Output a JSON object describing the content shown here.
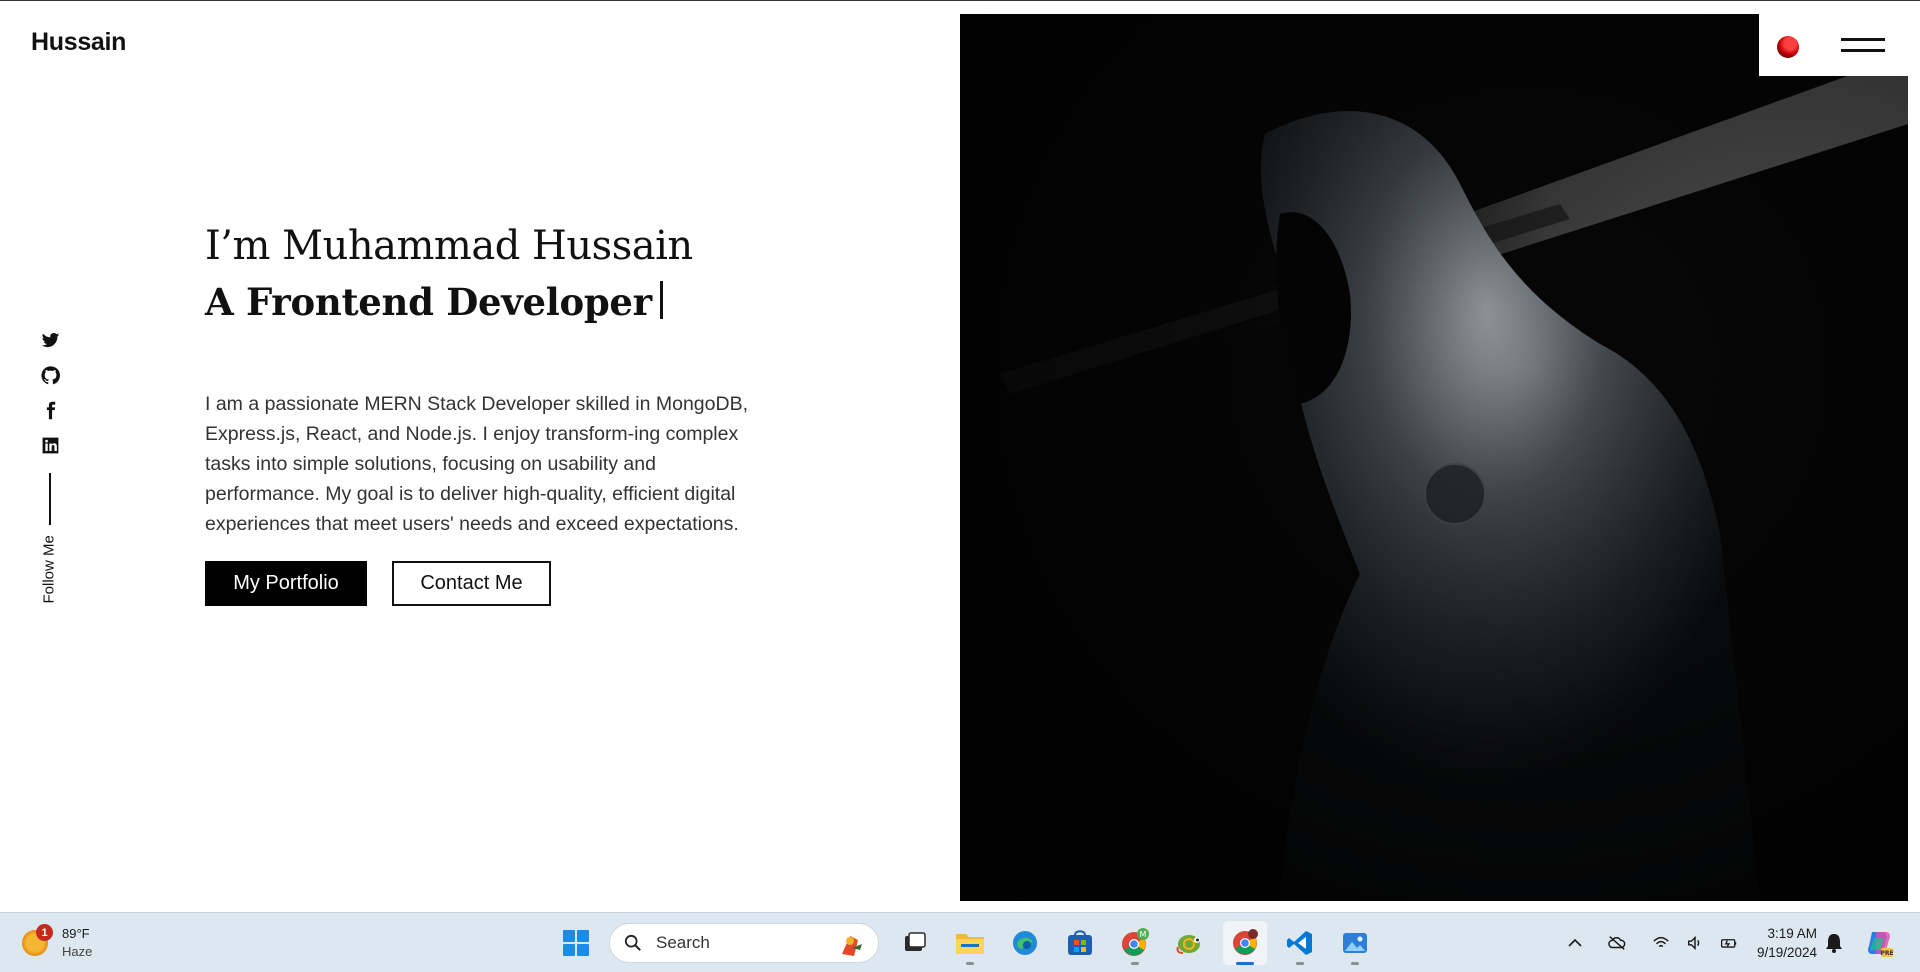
{
  "header": {
    "brand": "Hussain"
  },
  "social": {
    "items": [
      {
        "icon": "twitter-icon"
      },
      {
        "icon": "github-icon"
      },
      {
        "icon": "facebook-icon"
      },
      {
        "icon": "linkedin-icon"
      }
    ],
    "follow_label": "Follow Me"
  },
  "hero": {
    "greeting": "I’m Muhammad Hussain",
    "role": "A Frontend Developer",
    "description": "I am a passionate MERN Stack Developer skilled in MongoDB, Express.js, React, and Node.js. I enjoy transform-ing complex tasks into simple solutions, focusing on usability and performance. My goal is to deliver high-quality, efficient digital experiences that meet users' needs and exceed expectations.",
    "primary_button": "My Portfolio",
    "secondary_button": "Contact Me"
  },
  "nav": {
    "theme_toggle_icon": "red-dot-icon",
    "menu_icon": "hamburger-icon"
  },
  "taskbar": {
    "weather": {
      "temperature": "89°F",
      "condition": "Haze",
      "notification_count": "1"
    },
    "search_placeholder": "Search",
    "apps": [
      {
        "name": "start-button",
        "icon": "windows-icon"
      },
      {
        "name": "task-view",
        "icon": "task-view-icon"
      },
      {
        "name": "file-explorer",
        "icon": "folder-icon"
      },
      {
        "name": "edge",
        "icon": "edge-icon"
      },
      {
        "name": "microsoft-store",
        "icon": "store-icon"
      },
      {
        "name": "chrome-profile",
        "icon": "chrome-icon"
      },
      {
        "name": "chameleon-app",
        "icon": "chameleon-icon"
      },
      {
        "name": "chrome",
        "icon": "chrome-icon"
      },
      {
        "name": "vscode",
        "icon": "vscode-icon"
      },
      {
        "name": "photos",
        "icon": "photos-icon"
      }
    ],
    "clock": {
      "time": "3:19 AM",
      "date": "9/19/2024"
    }
  }
}
